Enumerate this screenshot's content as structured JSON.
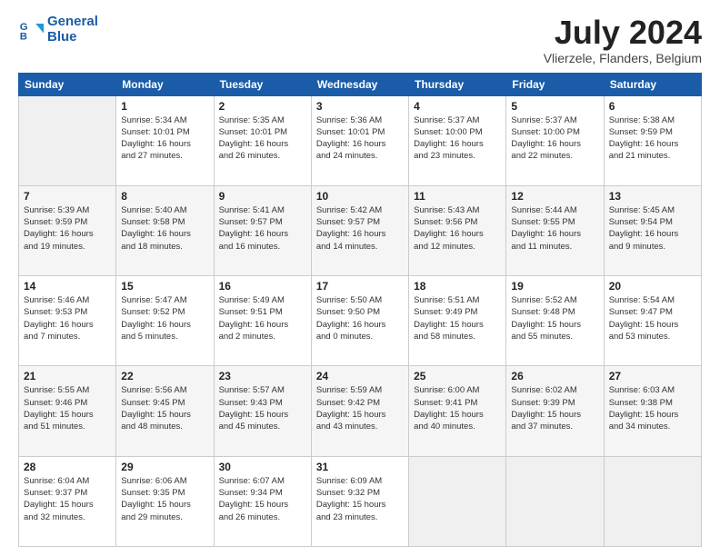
{
  "logo": {
    "line1": "General",
    "line2": "Blue"
  },
  "title": "July 2024",
  "subtitle": "Vlierzele, Flanders, Belgium",
  "days_of_week": [
    "Sunday",
    "Monday",
    "Tuesday",
    "Wednesday",
    "Thursday",
    "Friday",
    "Saturday"
  ],
  "weeks": [
    [
      {
        "num": "",
        "info": ""
      },
      {
        "num": "1",
        "info": "Sunrise: 5:34 AM\nSunset: 10:01 PM\nDaylight: 16 hours\nand 27 minutes."
      },
      {
        "num": "2",
        "info": "Sunrise: 5:35 AM\nSunset: 10:01 PM\nDaylight: 16 hours\nand 26 minutes."
      },
      {
        "num": "3",
        "info": "Sunrise: 5:36 AM\nSunset: 10:01 PM\nDaylight: 16 hours\nand 24 minutes."
      },
      {
        "num": "4",
        "info": "Sunrise: 5:37 AM\nSunset: 10:00 PM\nDaylight: 16 hours\nand 23 minutes."
      },
      {
        "num": "5",
        "info": "Sunrise: 5:37 AM\nSunset: 10:00 PM\nDaylight: 16 hours\nand 22 minutes."
      },
      {
        "num": "6",
        "info": "Sunrise: 5:38 AM\nSunset: 9:59 PM\nDaylight: 16 hours\nand 21 minutes."
      }
    ],
    [
      {
        "num": "7",
        "info": "Sunrise: 5:39 AM\nSunset: 9:59 PM\nDaylight: 16 hours\nand 19 minutes."
      },
      {
        "num": "8",
        "info": "Sunrise: 5:40 AM\nSunset: 9:58 PM\nDaylight: 16 hours\nand 18 minutes."
      },
      {
        "num": "9",
        "info": "Sunrise: 5:41 AM\nSunset: 9:57 PM\nDaylight: 16 hours\nand 16 minutes."
      },
      {
        "num": "10",
        "info": "Sunrise: 5:42 AM\nSunset: 9:57 PM\nDaylight: 16 hours\nand 14 minutes."
      },
      {
        "num": "11",
        "info": "Sunrise: 5:43 AM\nSunset: 9:56 PM\nDaylight: 16 hours\nand 12 minutes."
      },
      {
        "num": "12",
        "info": "Sunrise: 5:44 AM\nSunset: 9:55 PM\nDaylight: 16 hours\nand 11 minutes."
      },
      {
        "num": "13",
        "info": "Sunrise: 5:45 AM\nSunset: 9:54 PM\nDaylight: 16 hours\nand 9 minutes."
      }
    ],
    [
      {
        "num": "14",
        "info": "Sunrise: 5:46 AM\nSunset: 9:53 PM\nDaylight: 16 hours\nand 7 minutes."
      },
      {
        "num": "15",
        "info": "Sunrise: 5:47 AM\nSunset: 9:52 PM\nDaylight: 16 hours\nand 5 minutes."
      },
      {
        "num": "16",
        "info": "Sunrise: 5:49 AM\nSunset: 9:51 PM\nDaylight: 16 hours\nand 2 minutes."
      },
      {
        "num": "17",
        "info": "Sunrise: 5:50 AM\nSunset: 9:50 PM\nDaylight: 16 hours\nand 0 minutes."
      },
      {
        "num": "18",
        "info": "Sunrise: 5:51 AM\nSunset: 9:49 PM\nDaylight: 15 hours\nand 58 minutes."
      },
      {
        "num": "19",
        "info": "Sunrise: 5:52 AM\nSunset: 9:48 PM\nDaylight: 15 hours\nand 55 minutes."
      },
      {
        "num": "20",
        "info": "Sunrise: 5:54 AM\nSunset: 9:47 PM\nDaylight: 15 hours\nand 53 minutes."
      }
    ],
    [
      {
        "num": "21",
        "info": "Sunrise: 5:55 AM\nSunset: 9:46 PM\nDaylight: 15 hours\nand 51 minutes."
      },
      {
        "num": "22",
        "info": "Sunrise: 5:56 AM\nSunset: 9:45 PM\nDaylight: 15 hours\nand 48 minutes."
      },
      {
        "num": "23",
        "info": "Sunrise: 5:57 AM\nSunset: 9:43 PM\nDaylight: 15 hours\nand 45 minutes."
      },
      {
        "num": "24",
        "info": "Sunrise: 5:59 AM\nSunset: 9:42 PM\nDaylight: 15 hours\nand 43 minutes."
      },
      {
        "num": "25",
        "info": "Sunrise: 6:00 AM\nSunset: 9:41 PM\nDaylight: 15 hours\nand 40 minutes."
      },
      {
        "num": "26",
        "info": "Sunrise: 6:02 AM\nSunset: 9:39 PM\nDaylight: 15 hours\nand 37 minutes."
      },
      {
        "num": "27",
        "info": "Sunrise: 6:03 AM\nSunset: 9:38 PM\nDaylight: 15 hours\nand 34 minutes."
      }
    ],
    [
      {
        "num": "28",
        "info": "Sunrise: 6:04 AM\nSunset: 9:37 PM\nDaylight: 15 hours\nand 32 minutes."
      },
      {
        "num": "29",
        "info": "Sunrise: 6:06 AM\nSunset: 9:35 PM\nDaylight: 15 hours\nand 29 minutes."
      },
      {
        "num": "30",
        "info": "Sunrise: 6:07 AM\nSunset: 9:34 PM\nDaylight: 15 hours\nand 26 minutes."
      },
      {
        "num": "31",
        "info": "Sunrise: 6:09 AM\nSunset: 9:32 PM\nDaylight: 15 hours\nand 23 minutes."
      },
      {
        "num": "",
        "info": ""
      },
      {
        "num": "",
        "info": ""
      },
      {
        "num": "",
        "info": ""
      }
    ]
  ]
}
